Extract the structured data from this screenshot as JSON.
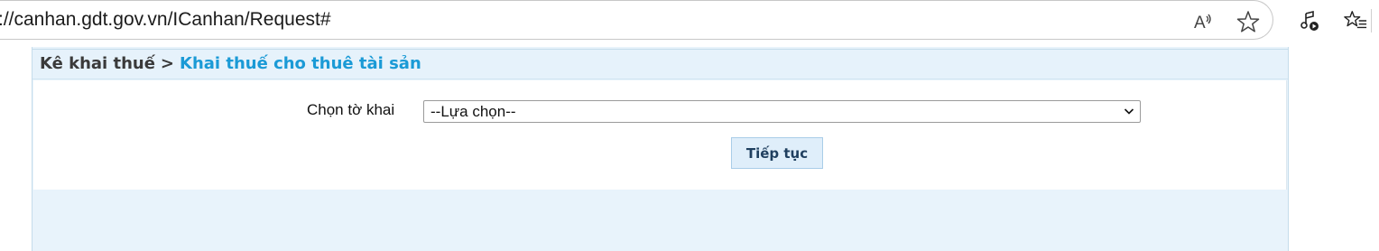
{
  "browser": {
    "url": "://canhan.gdt.gov.vn/ICanhan/Request#",
    "icons": [
      "read-aloud-icon",
      "favorite-star-icon",
      "media-control-icon",
      "favorites-list-icon"
    ]
  },
  "breadcrumb": {
    "parent": "Kê khai thuế",
    "separator": ">",
    "current": "Khai thuế cho thuê tài sản"
  },
  "form": {
    "label": "Chọn tờ khai",
    "select_value": "--Lựa chọn--",
    "continue_label": "Tiếp tục"
  },
  "colors": {
    "breadcrumb_accent": "#1a9ad6",
    "panel_background": "#e8f3fb",
    "button_background": "#dfeefa"
  }
}
